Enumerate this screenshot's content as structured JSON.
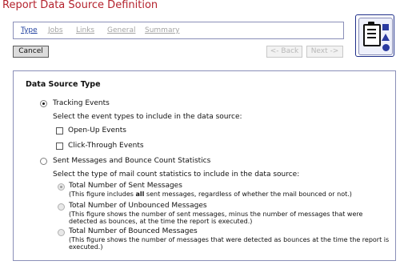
{
  "page_title": "Report Data Source Definition",
  "tabs": [
    "Type",
    "Jobs",
    "Links",
    "General",
    "Summary"
  ],
  "buttons": {
    "cancel": "Cancel",
    "back": "<- Back",
    "next": "Next ->"
  },
  "wizard_icon": "clipboard-wizard-icon",
  "section": {
    "title": "Data Source Type",
    "tracking": {
      "label": "Tracking Events",
      "selected": true,
      "prompt": "Select the event types to include in the data source:",
      "options": [
        {
          "label": "Open-Up Events",
          "checked": false
        },
        {
          "label": "Click-Through Events",
          "checked": false
        }
      ]
    },
    "sent": {
      "label": "Sent Messages and Bounce Count Statistics",
      "selected": false,
      "prompt": "Select the type of mail count statistics to include in the data source:",
      "options": [
        {
          "label": "Total Number of Sent Messages",
          "selected": true,
          "desc_pre": "(This figure includes ",
          "desc_bold": "all",
          "desc_post": " sent messages, regardless of whether the mail bounced or not.)"
        },
        {
          "label": "Total Number of Unbounced Messages",
          "selected": false,
          "desc_line1": "(This figure shows the number of sent messages, minus the number of messages that were",
          "desc_line2": "detected as bounces, at the time the report is executed.)"
        },
        {
          "label": "Total Number of Bounced Messages",
          "selected": false,
          "desc_line1": "(This figure shows the number of messages that were detected as bounces at the time the report is",
          "desc_line2": "executed.)"
        }
      ]
    }
  }
}
